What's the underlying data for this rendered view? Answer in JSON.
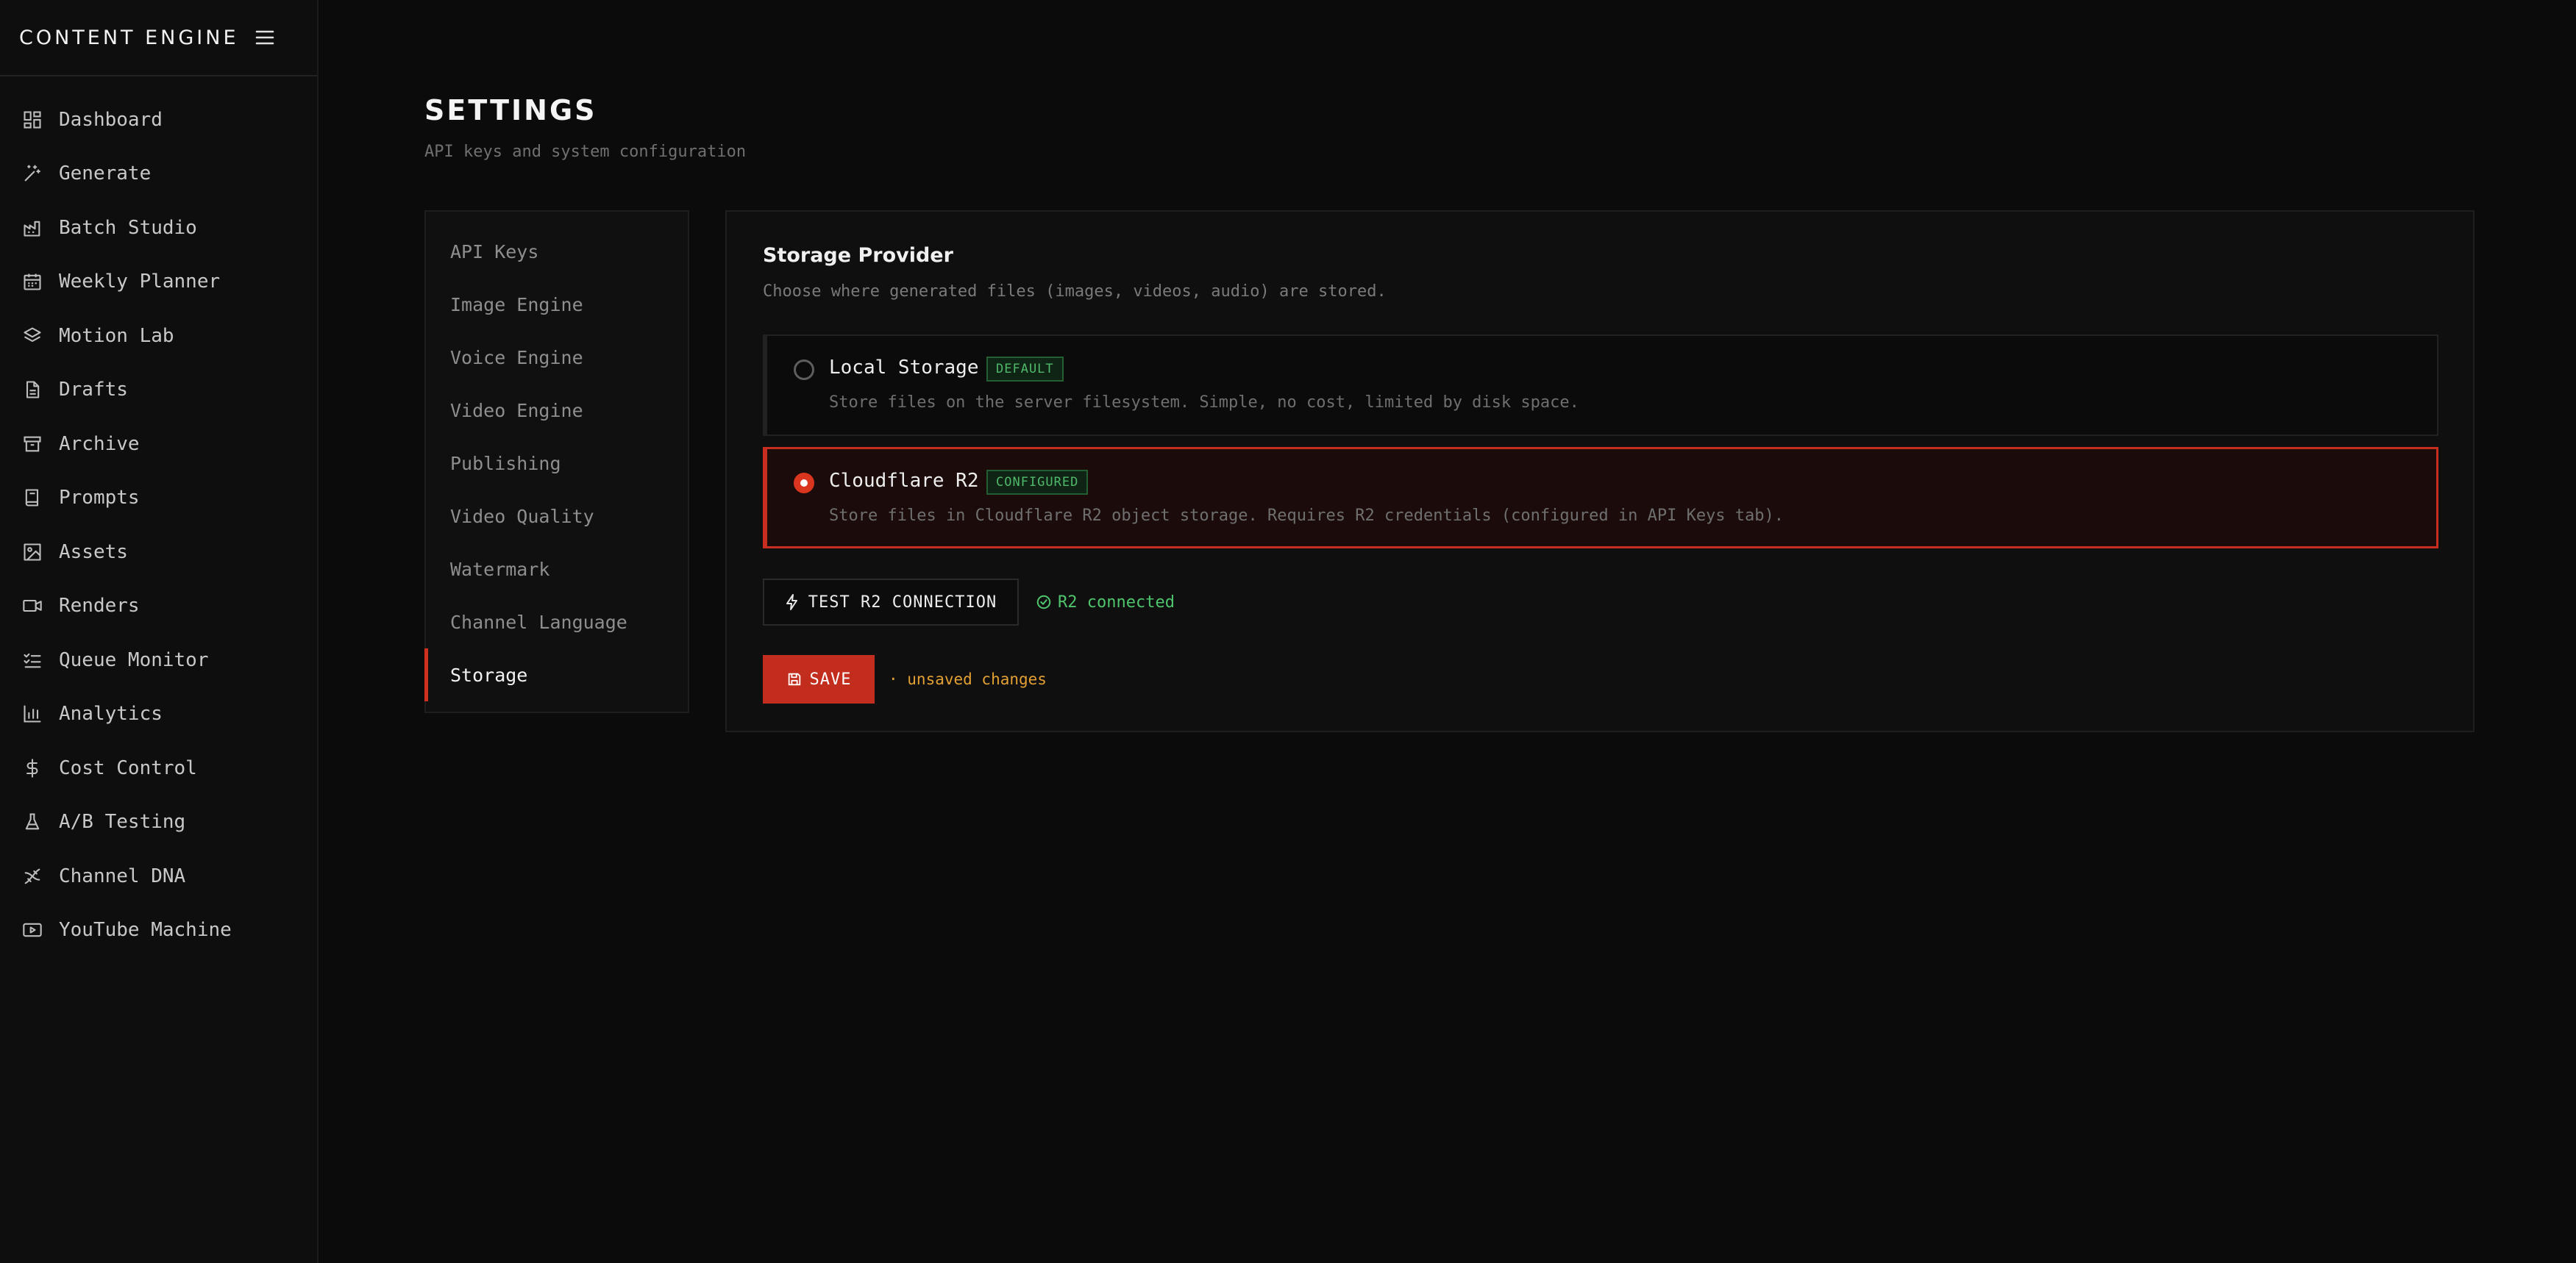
{
  "app": {
    "brand": "CONTENT ENGINE"
  },
  "sidebar": {
    "items": [
      {
        "label": "Dashboard",
        "icon": "dashboard-grid-icon"
      },
      {
        "label": "Generate",
        "icon": "sparkle-wand-icon"
      },
      {
        "label": "Batch Studio",
        "icon": "factory-icon"
      },
      {
        "label": "Weekly Planner",
        "icon": "calendar-icon"
      },
      {
        "label": "Motion Lab",
        "icon": "layers-icon"
      },
      {
        "label": "Drafts",
        "icon": "document-icon"
      },
      {
        "label": "Archive",
        "icon": "archive-box-icon"
      },
      {
        "label": "Prompts",
        "icon": "book-icon"
      },
      {
        "label": "Assets",
        "icon": "image-icon"
      },
      {
        "label": "Renders",
        "icon": "video-camera-icon"
      },
      {
        "label": "Queue Monitor",
        "icon": "checklist-icon"
      },
      {
        "label": "Analytics",
        "icon": "bar-chart-icon"
      },
      {
        "label": "Cost Control",
        "icon": "dollar-icon"
      },
      {
        "label": "A/B Testing",
        "icon": "flask-icon"
      },
      {
        "label": "Channel DNA",
        "icon": "dna-icon"
      },
      {
        "label": "YouTube Machine",
        "icon": "play-screen-icon"
      }
    ]
  },
  "page": {
    "title": "SETTINGS",
    "subtitle": "API keys and system configuration"
  },
  "tabs": {
    "items": [
      "API Keys",
      "Image Engine",
      "Voice Engine",
      "Video Engine",
      "Publishing",
      "Video Quality",
      "Watermark",
      "Channel Language",
      "Storage"
    ],
    "active": "Storage"
  },
  "storage": {
    "title": "Storage Provider",
    "description": "Choose where generated files (images, videos, audio) are stored.",
    "options": [
      {
        "name": "Local Storage",
        "badge": "DEFAULT",
        "description": "Store files on the server filesystem. Simple, no cost, limited by disk space.",
        "selected": false
      },
      {
        "name": "Cloudflare R2",
        "badge": "CONFIGURED",
        "description": "Store files in Cloudflare R2 object storage. Requires R2 credentials (configured in API Keys tab).",
        "selected": true
      }
    ],
    "test_button": "TEST R2 CONNECTION",
    "status": "R2 connected",
    "save_button": "SAVE",
    "unsaved_note": "· unsaved changes"
  },
  "colors": {
    "accent": "#c22d1e",
    "success": "#4fc46c",
    "warning": "#e3a033",
    "background": "#0b0b0b"
  }
}
